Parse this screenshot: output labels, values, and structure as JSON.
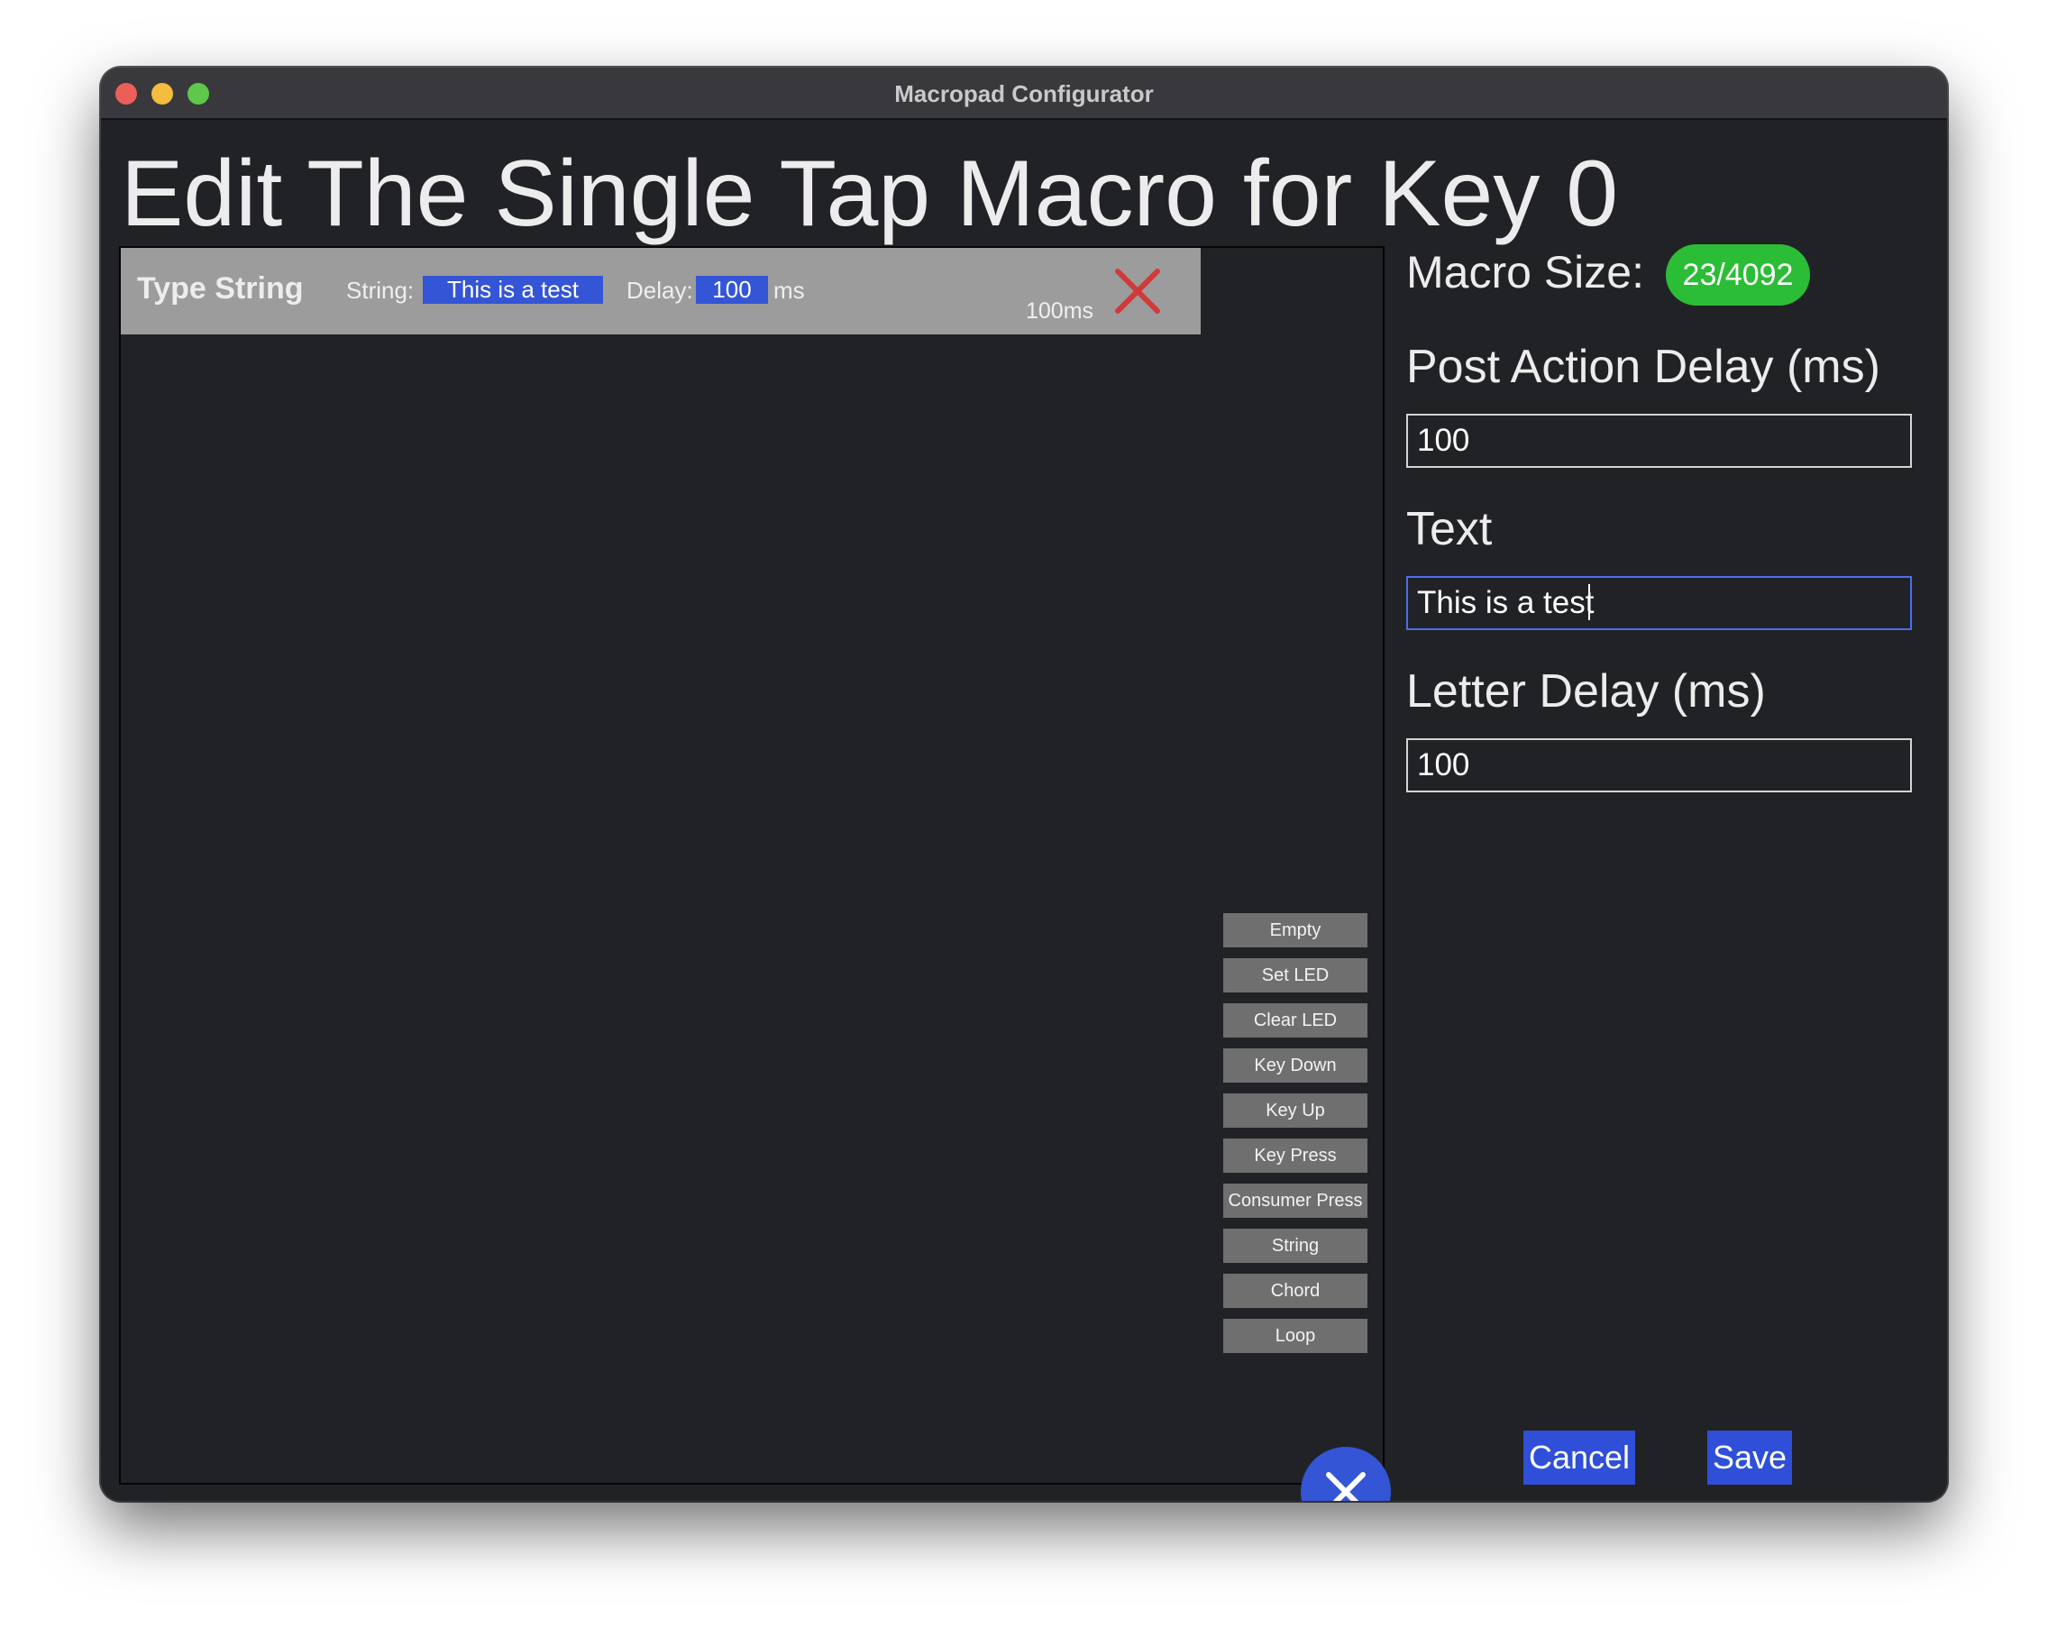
{
  "window": {
    "title": "Macropad Configurator",
    "controls": [
      "close",
      "minimize",
      "maximize"
    ]
  },
  "page": {
    "title": "Edit The Single Tap Macro for Key 0"
  },
  "macro_actions": [
    {
      "type_label": "Type String",
      "string_label": "String:",
      "string_value": "This is a test",
      "delay_label": "Delay:",
      "delay_value": "100",
      "delay_unit": "ms",
      "footnote": "100ms",
      "remove_icon": "x-icon"
    }
  ],
  "palette": {
    "buttons": [
      "Empty",
      "Set LED",
      "Clear LED",
      "Key Down",
      "Key Up",
      "Key Press",
      "Consumer Press",
      "String",
      "Chord",
      "Loop"
    ],
    "close_icon": "x-icon"
  },
  "sidebar": {
    "macro_size_label": "Macro Size:",
    "macro_size_value": "23/4092",
    "fields": [
      {
        "label": "Post Action Delay (ms)",
        "value": "100",
        "focused": false
      },
      {
        "label": "Text",
        "value": "This is a test",
        "focused": true
      },
      {
        "label": "Letter Delay (ms)",
        "value": "100",
        "focused": false
      }
    ],
    "cancel_label": "Cancel",
    "save_label": "Save"
  },
  "colors": {
    "window_bg": "#212226",
    "titlebar": "#39393d",
    "accent_blue": "#3355d6",
    "badge_green": "#2bbd36",
    "action_row": "#9c9c9c",
    "palette_button": "#6f6f6f",
    "remove_red": "#d23a3a"
  }
}
